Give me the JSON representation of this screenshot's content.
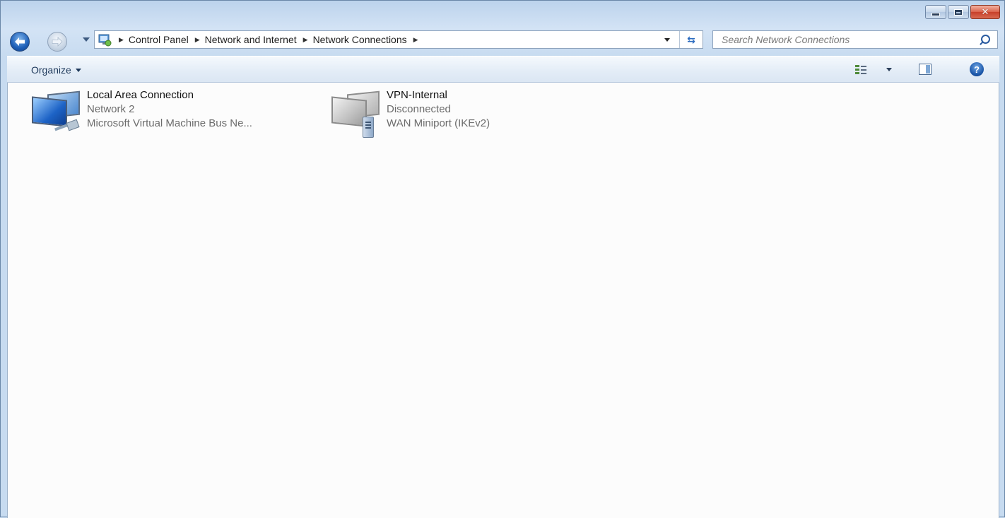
{
  "window": {
    "caption_buttons": {
      "minimize": "minimize-icon",
      "maximize": "maximize-icon",
      "close": "close-icon"
    }
  },
  "nav": {
    "breadcrumbs": [
      "Control Panel",
      "Network and Internet",
      "Network Connections"
    ],
    "search_placeholder": "Search Network Connections"
  },
  "toolbar": {
    "organize_label": "Organize"
  },
  "connections": [
    {
      "name": "Local Area Connection",
      "network": "Network  2",
      "device": "Microsoft Virtual Machine Bus Ne...",
      "icon": "network-adapter-icon"
    },
    {
      "name": "VPN-Internal",
      "network": "Disconnected",
      "device": "WAN Miniport (IKEv2)",
      "icon": "vpn-connection-icon"
    }
  ],
  "colors": {
    "accent": "#1d5fb8",
    "close_red": "#c7402a"
  }
}
